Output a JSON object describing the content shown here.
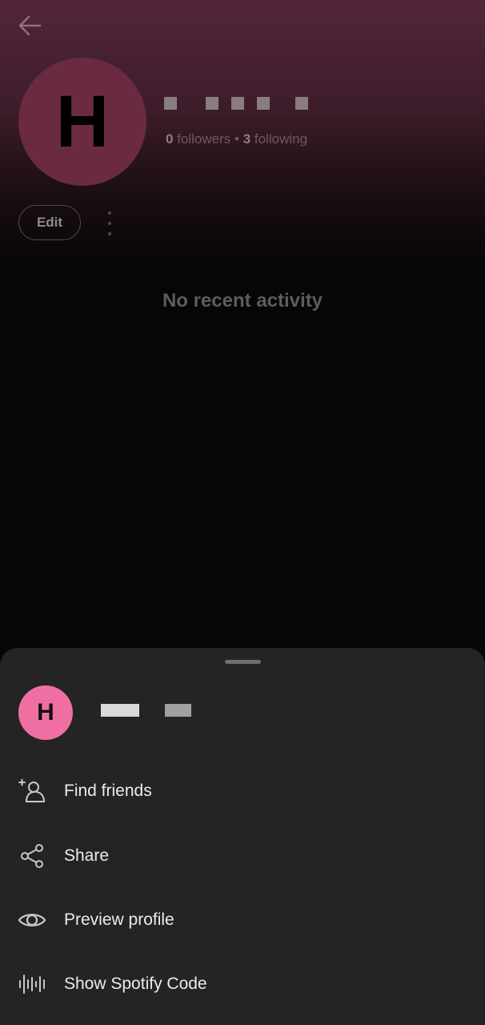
{
  "header": {
    "back_icon": "arrow-left-icon",
    "avatar_initial": "H",
    "display_name": "redacted",
    "followers_count": "0",
    "followers_label": "followers",
    "separator": "•",
    "following_count": "3",
    "following_label": "following",
    "edit_label": "Edit",
    "more_icon": "more-vertical-icon"
  },
  "main": {
    "empty_state": "No recent activity"
  },
  "sheet": {
    "avatar_initial": "H",
    "display_name": "redacted",
    "items": [
      {
        "label": "Find friends",
        "icon": "add-person-icon"
      },
      {
        "label": "Share",
        "icon": "share-icon"
      },
      {
        "label": "Preview profile",
        "icon": "eye-icon"
      },
      {
        "label": "Show Spotify Code",
        "icon": "spotify-code-icon"
      }
    ]
  },
  "colors": {
    "header_gradient_top": "#52253a",
    "avatar_large": "#6a2b42",
    "avatar_small": "#f06fa3",
    "sheet_bg": "#242424",
    "background": "#060606"
  }
}
